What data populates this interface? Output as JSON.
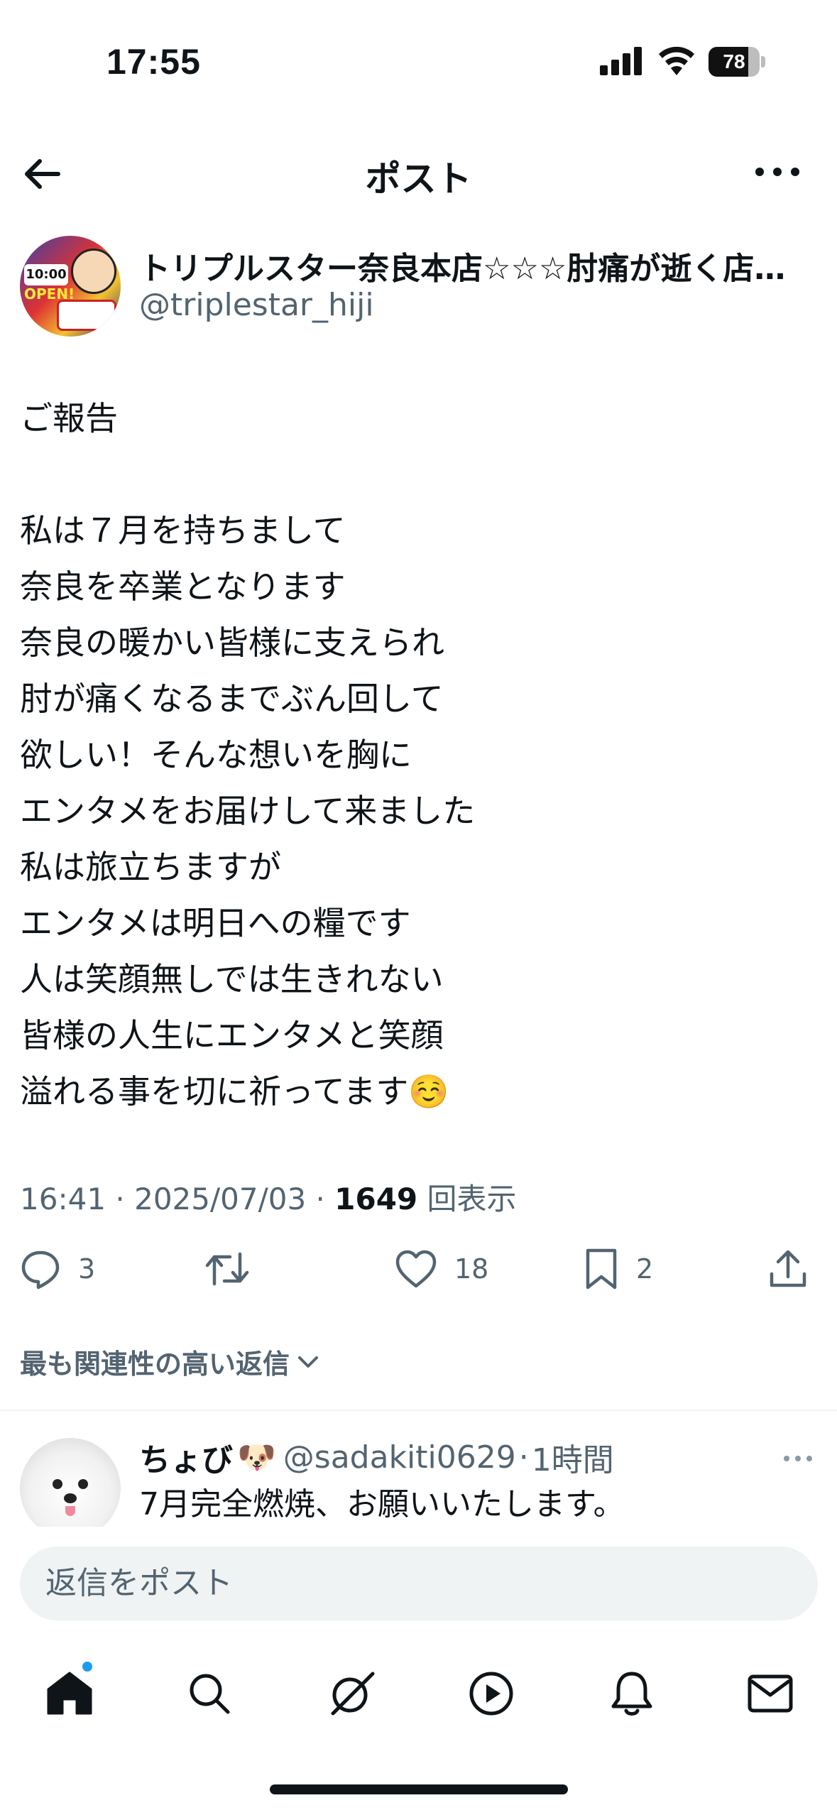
{
  "status_bar": {
    "time": "17:55",
    "battery": "78",
    "battery_level": 0.78
  },
  "nav": {
    "title": "ポスト",
    "back_icon": "arrow-left-icon",
    "more_icon": "more-horizontal-icon"
  },
  "author": {
    "display_name": "トリプルスター奈良本店☆☆☆肘痛が逝く店…",
    "handle": "@triplestar_hiji",
    "avatar_text_1": "10:00",
    "avatar_text_2": "OPEN!"
  },
  "post": {
    "body": "ご報告\n\n私は７月を持ちまして\n奈良を卒業となります\n奈良の暖かい皆様に支えられ\n肘が痛くなるまでぶん回して\n欲しい！そんな想いを胸に\nエンタメをお届けして来ました\n私は旅立ちますが\nエンタメは明日への糧です\n人は笑顔無しでは生きれない\n皆様の人生にエンタメと笑顔\n溢れる事を切に祈ってます☺️",
    "time": "16:41",
    "separator": " · ",
    "date": "2025/07/03",
    "views": "1649",
    "views_label": " 回表示"
  },
  "actions": {
    "replies": "3",
    "retweets": "",
    "likes": "18",
    "bookmarks": "2"
  },
  "replies_section": {
    "sort_label": "最も関連性の高い返信"
  },
  "reply": {
    "name": "ちょび",
    "emoji": "🐶",
    "handle": "@sadakiti0629",
    "dot": "·",
    "time_ago": "1時間",
    "text": "7月完全燃焼、お願いいたします。"
  },
  "composer": {
    "placeholder": "返信をポスト"
  },
  "bottom_nav": {
    "tabs": [
      "home-icon",
      "search-icon",
      "grok-icon",
      "video-icon",
      "notifications-icon",
      "messages-icon"
    ]
  },
  "colors": {
    "text": "#0f1419",
    "secondary": "#536471",
    "accent": "#1d9bf0",
    "input_bg": "#eff3f4"
  }
}
